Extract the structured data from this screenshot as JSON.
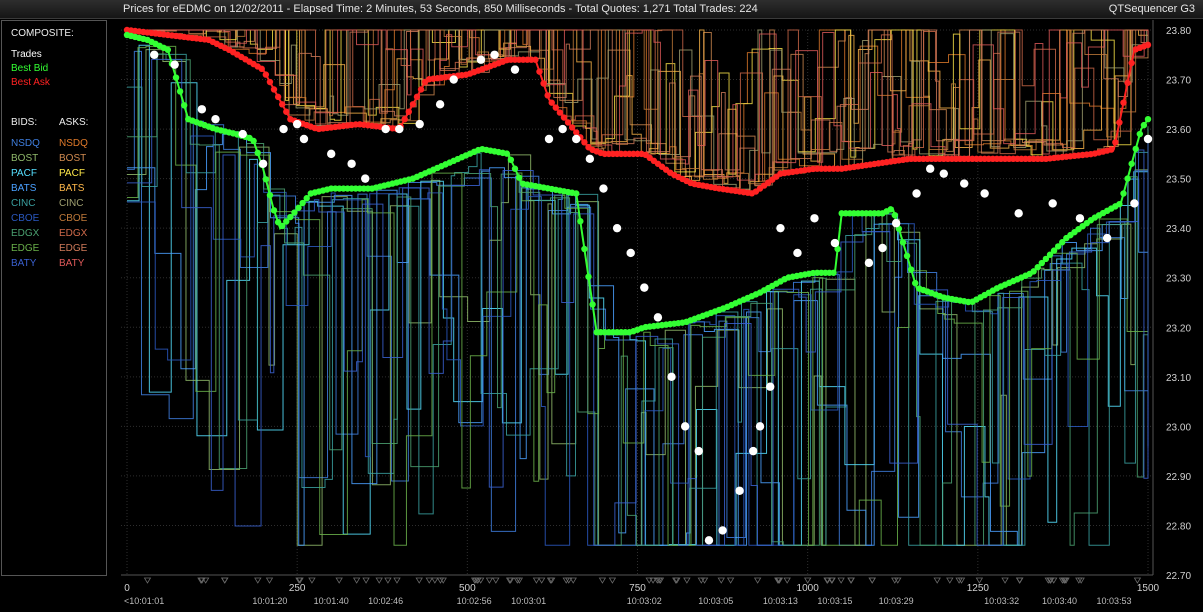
{
  "window": {
    "title": "Prices for  eEDMC  on  12/02/2011  -  Elapsed Time: 2 Minutes, 53 Seconds, 850 Milliseconds  -  Total Quotes: 1,271  Total Trades: 224",
    "brand": "QTSequencer G3"
  },
  "legend": {
    "composite_header": "COMPOSITE:",
    "composite": [
      {
        "label": "Trades",
        "color": "#ffffff"
      },
      {
        "label": "Best Bid",
        "color": "#33ff33"
      },
      {
        "label": "Best Ask",
        "color": "#ff2222"
      }
    ],
    "bids_header": "BIDS:",
    "asks_header": "ASKS:",
    "exchanges": [
      {
        "bid": "NSDQ",
        "ask": "NSDQ",
        "bid_color": "#3f7fe0",
        "ask_color": "#e07a2a"
      },
      {
        "bid": "BOST",
        "ask": "BOST",
        "bid_color": "#8fb86a",
        "ask_color": "#d08a50"
      },
      {
        "bid": "PACF",
        "ask": "PACF",
        "bid_color": "#55e0ff",
        "ask_color": "#ffe84a"
      },
      {
        "bid": "BATS",
        "ask": "BATS",
        "bid_color": "#4aa0ff",
        "ask_color": "#ffb84a"
      },
      {
        "bid": "CINC",
        "ask": "CINC",
        "bid_color": "#3aa0a0",
        "ask_color": "#a0a070"
      },
      {
        "bid": "CBOE",
        "ask": "CBOE",
        "bid_color": "#2a58c0",
        "ask_color": "#c07a3a"
      },
      {
        "bid": "EDGX",
        "ask": "EDGX",
        "bid_color": "#4aa070",
        "ask_color": "#d06a4a"
      },
      {
        "bid": "EDGE",
        "ask": "EDGE",
        "bid_color": "#6ab04a",
        "ask_color": "#d07a5a"
      },
      {
        "bid": "BATY",
        "ask": "BATY",
        "bid_color": "#3a60d0",
        "ask_color": "#e05a5a"
      }
    ]
  },
  "chart_data": {
    "type": "line",
    "x_axis": {
      "range": [
        0,
        1500
      ],
      "ticks": [
        0,
        250,
        500,
        750,
        1000,
        1250,
        1500
      ]
    },
    "y_axis": {
      "range": [
        22.7,
        23.8
      ],
      "side": "right",
      "ticks": [
        "23.80",
        "23.70",
        "23.60",
        "23.50",
        "23.40",
        "23.30",
        "23.20",
        "23.10",
        "23.00",
        "22.90",
        "22.80",
        "22.70"
      ]
    },
    "time_labels": [
      {
        "x": 0,
        "label": "<10:01:01"
      },
      {
        "x": 210,
        "label": "10:01:20"
      },
      {
        "x": 300,
        "label": "10:01:40"
      },
      {
        "x": 380,
        "label": "10:02:46"
      },
      {
        "x": 510,
        "label": "10:02:56"
      },
      {
        "x": 590,
        "label": "10:03:01"
      },
      {
        "x": 760,
        "label": "10:03:02"
      },
      {
        "x": 865,
        "label": "10:03:05"
      },
      {
        "x": 960,
        "label": "10:03:13"
      },
      {
        "x": 1040,
        "label": "10:03:15"
      },
      {
        "x": 1130,
        "label": "10:03:29"
      },
      {
        "x": 1285,
        "label": "10:03:32"
      },
      {
        "x": 1370,
        "label": "10:03:40"
      },
      {
        "x": 1450,
        "label": "10:03:53"
      }
    ],
    "grid": true,
    "legend_placement": "left-panel",
    "series": [
      {
        "name": "Best Bid",
        "color": "#33ff33",
        "points": [
          [
            0,
            23.79
          ],
          [
            30,
            23.78
          ],
          [
            60,
            23.76
          ],
          [
            90,
            23.62
          ],
          [
            130,
            23.6
          ],
          [
            160,
            23.59
          ],
          [
            185,
            23.58
          ],
          [
            200,
            23.52
          ],
          [
            215,
            23.44
          ],
          [
            225,
            23.4
          ],
          [
            245,
            23.43
          ],
          [
            270,
            23.47
          ],
          [
            300,
            23.48
          ],
          [
            360,
            23.48
          ],
          [
            420,
            23.5
          ],
          [
            470,
            23.53
          ],
          [
            520,
            23.56
          ],
          [
            560,
            23.55
          ],
          [
            580,
            23.49
          ],
          [
            620,
            23.48
          ],
          [
            660,
            23.47
          ],
          [
            690,
            23.19
          ],
          [
            740,
            23.19
          ],
          [
            760,
            23.2
          ],
          [
            820,
            23.21
          ],
          [
            880,
            23.24
          ],
          [
            930,
            23.27
          ],
          [
            970,
            23.3
          ],
          [
            1010,
            23.31
          ],
          [
            1040,
            23.31
          ],
          [
            1050,
            23.43
          ],
          [
            1110,
            23.43
          ],
          [
            1125,
            23.44
          ],
          [
            1160,
            23.28
          ],
          [
            1200,
            23.26
          ],
          [
            1240,
            23.25
          ],
          [
            1280,
            23.28
          ],
          [
            1330,
            23.31
          ],
          [
            1380,
            23.38
          ],
          [
            1420,
            23.42
          ],
          [
            1460,
            23.45
          ],
          [
            1490,
            23.6
          ],
          [
            1500,
            23.62
          ]
        ]
      },
      {
        "name": "Best Ask",
        "color": "#ff2222",
        "points": [
          [
            0,
            23.8
          ],
          [
            120,
            23.78
          ],
          [
            150,
            23.76
          ],
          [
            200,
            23.72
          ],
          [
            240,
            23.62
          ],
          [
            280,
            23.6
          ],
          [
            340,
            23.61
          ],
          [
            400,
            23.6
          ],
          [
            440,
            23.7
          ],
          [
            500,
            23.71
          ],
          [
            560,
            23.74
          ],
          [
            600,
            23.74
          ],
          [
            620,
            23.66
          ],
          [
            650,
            23.61
          ],
          [
            680,
            23.56
          ],
          [
            700,
            23.55
          ],
          [
            760,
            23.55
          ],
          [
            800,
            23.51
          ],
          [
            830,
            23.49
          ],
          [
            870,
            23.48
          ],
          [
            920,
            23.47
          ],
          [
            960,
            23.51
          ],
          [
            1010,
            23.52
          ],
          [
            1050,
            23.52
          ],
          [
            1100,
            23.53
          ],
          [
            1150,
            23.54
          ],
          [
            1250,
            23.54
          ],
          [
            1350,
            23.54
          ],
          [
            1420,
            23.55
          ],
          [
            1450,
            23.56
          ],
          [
            1480,
            23.76
          ],
          [
            1500,
            23.77
          ]
        ]
      }
    ],
    "trades": [
      [
        40,
        23.75
      ],
      [
        70,
        23.73
      ],
      [
        110,
        23.64
      ],
      [
        130,
        23.62
      ],
      [
        170,
        23.59
      ],
      [
        200,
        23.53
      ],
      [
        230,
        23.6
      ],
      [
        250,
        23.61
      ],
      [
        260,
        23.58
      ],
      [
        300,
        23.55
      ],
      [
        330,
        23.53
      ],
      [
        350,
        23.5
      ],
      [
        380,
        23.6
      ],
      [
        400,
        23.6
      ],
      [
        430,
        23.61
      ],
      [
        460,
        23.65
      ],
      [
        480,
        23.7
      ],
      [
        520,
        23.74
      ],
      [
        540,
        23.75
      ],
      [
        570,
        23.72
      ],
      [
        620,
        23.58
      ],
      [
        640,
        23.6
      ],
      [
        660,
        23.58
      ],
      [
        680,
        23.54
      ],
      [
        700,
        23.48
      ],
      [
        720,
        23.4
      ],
      [
        740,
        23.35
      ],
      [
        760,
        23.28
      ],
      [
        780,
        23.22
      ],
      [
        800,
        23.1
      ],
      [
        820,
        23.0
      ],
      [
        840,
        22.95
      ],
      [
        855,
        22.77
      ],
      [
        875,
        22.79
      ],
      [
        900,
        22.87
      ],
      [
        920,
        22.95
      ],
      [
        930,
        23.0
      ],
      [
        945,
        23.08
      ],
      [
        960,
        23.4
      ],
      [
        985,
        23.35
      ],
      [
        1010,
        23.42
      ],
      [
        1040,
        23.37
      ],
      [
        1090,
        23.33
      ],
      [
        1110,
        23.36
      ],
      [
        1130,
        23.41
      ],
      [
        1160,
        23.47
      ],
      [
        1180,
        23.52
      ],
      [
        1200,
        23.51
      ],
      [
        1230,
        23.49
      ],
      [
        1260,
        23.47
      ],
      [
        1310,
        23.43
      ],
      [
        1360,
        23.45
      ],
      [
        1400,
        23.42
      ],
      [
        1440,
        23.38
      ],
      [
        1480,
        23.45
      ],
      [
        1500,
        23.58
      ]
    ]
  }
}
